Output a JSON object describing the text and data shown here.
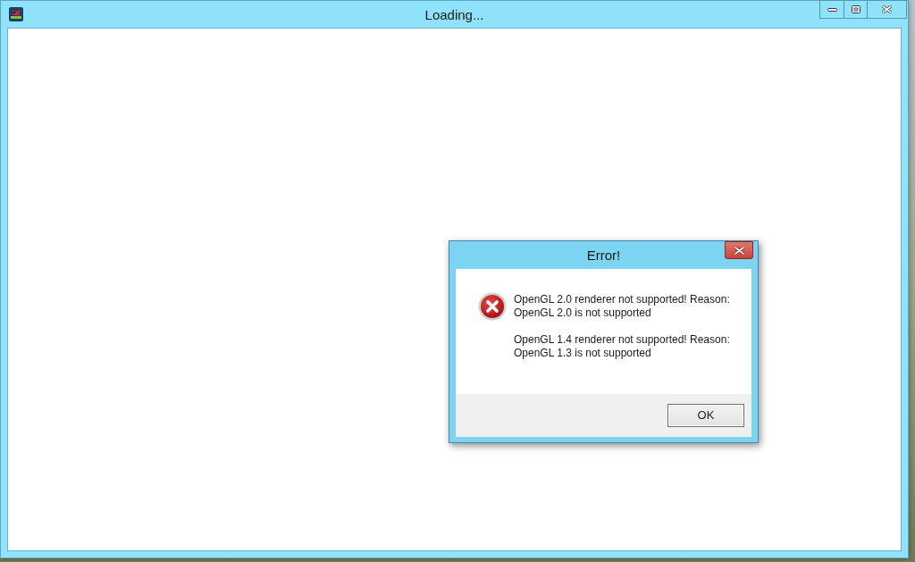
{
  "window": {
    "title": "Loading..."
  },
  "dialog": {
    "title": "Error!",
    "messages": [
      "OpenGL 2.0 renderer not supported! Reason:\nOpenGL 2.0 is not supported",
      "OpenGL 1.4 renderer not supported! Reason:\nOpenGL 1.3 is not supported"
    ],
    "buttons": [
      "OK"
    ]
  }
}
